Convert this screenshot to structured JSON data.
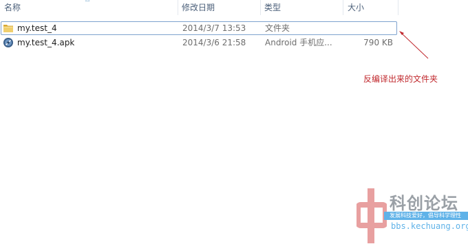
{
  "columns": {
    "name": "名称",
    "modified": "修改日期",
    "type": "类型",
    "size": "大小"
  },
  "files": [
    {
      "name": "my.test_4",
      "modified": "2014/3/7 13:53",
      "type": "文件夹",
      "size": "",
      "icon": "folder-icon",
      "selected": true
    },
    {
      "name": "my.test_4.apk",
      "modified": "2014/3/6 21:58",
      "type": "Android 手机应...",
      "size": "790 KB",
      "icon": "apk-icon",
      "selected": false
    }
  ],
  "annotation": {
    "text": "反编译出来的文件夹",
    "color": "#c0282d"
  },
  "watermark": {
    "title": "科创论坛",
    "slogan": "发展科技爱好，倡导科学理性",
    "url": "bbs.kechuang.org"
  },
  "colors": {
    "selection_border": "#7da2ce",
    "header_text": "#4c607a",
    "folder": "#e8c35a"
  }
}
